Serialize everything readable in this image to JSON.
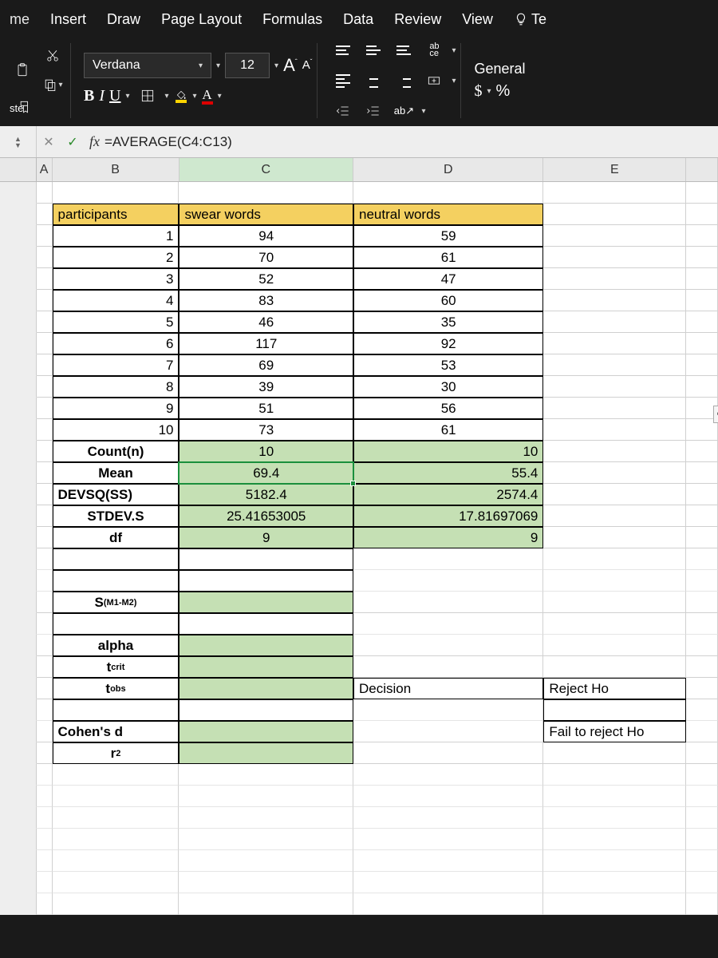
{
  "tabs": {
    "home": "me",
    "insert": "Insert",
    "draw": "Draw",
    "layout": "Page Layout",
    "formulas": "Formulas",
    "data": "Data",
    "review": "Review",
    "view": "View",
    "tell": "Te"
  },
  "paste_label": "ste",
  "font": {
    "name": "Verdana",
    "size": "12",
    "bold": "B",
    "italic": "I",
    "underline": "U",
    "growA": "A",
    "shrinkA": "A"
  },
  "number_format": "General",
  "currency": "$",
  "percent": "%",
  "formula_bar": "=AVERAGE(C4:C13)",
  "fx_label": "fx",
  "cols": {
    "A": "A",
    "B": "B",
    "C": "C",
    "D": "D",
    "E": "E"
  },
  "headers": {
    "participants": "participants",
    "swear": "swear words",
    "neutral": "neutral words"
  },
  "rows": [
    {
      "p": "1",
      "s": "94",
      "n": "59"
    },
    {
      "p": "2",
      "s": "70",
      "n": "61"
    },
    {
      "p": "3",
      "s": "52",
      "n": "47"
    },
    {
      "p": "4",
      "s": "83",
      "n": "60"
    },
    {
      "p": "5",
      "s": "46",
      "n": "35"
    },
    {
      "p": "6",
      "s": "117",
      "n": "92"
    },
    {
      "p": "7",
      "s": "69",
      "n": "53"
    },
    {
      "p": "8",
      "s": "39",
      "n": "30"
    },
    {
      "p": "9",
      "s": "51",
      "n": "56"
    },
    {
      "p": "10",
      "s": "73",
      "n": "61"
    }
  ],
  "stats": {
    "count_l": "Count(n)",
    "count_s": "10",
    "count_n": "10",
    "mean_l": "Mean",
    "mean_s": "69.4",
    "mean_n": "55.4",
    "devsq_l": "DEVSQ(SS)",
    "devsq_s": "5182.4",
    "devsq_n": "2574.4",
    "stdev_l": "STDEV.S",
    "stdev_s": "25.41653005",
    "stdev_n": "17.81697069",
    "df_l": "df",
    "df_s": "9",
    "df_n": "9"
  },
  "extra": {
    "sm1m2": "S",
    "sm1m2_sub": "(M1-M2)",
    "alpha": "alpha",
    "tcrit": "t",
    "tcrit_sub": "crit",
    "tobs": "t",
    "tobs_sub": "obs",
    "decision": "Decision",
    "reject": "Reject Ho",
    "cohen": "Cohen's d",
    "fail": "Fail to reject Ho",
    "r2": "r",
    "r2_sup": "2"
  }
}
